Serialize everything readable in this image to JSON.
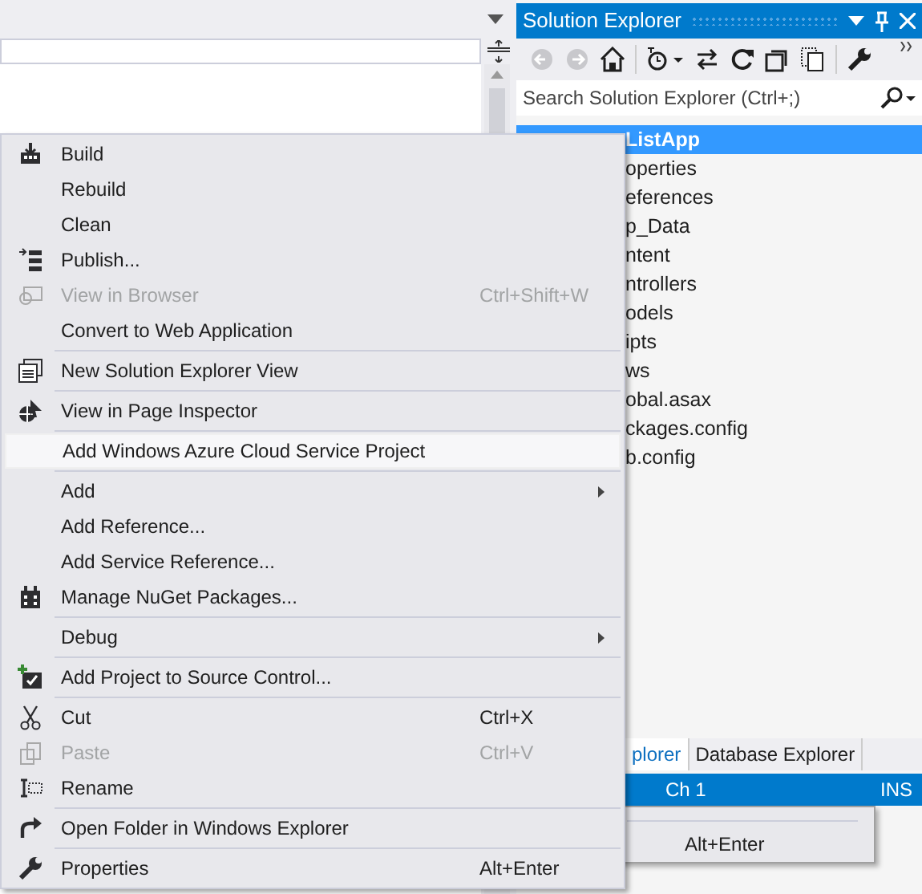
{
  "solution_explorer": {
    "title": "Solution Explorer",
    "search": {
      "placeholder": "Search Solution Explorer (Ctrl+;)"
    },
    "tree": [
      {
        "label": "ListApp",
        "selected": true
      },
      {
        "label": "operties",
        "selected": false
      },
      {
        "label": "eferences",
        "selected": false
      },
      {
        "label": "p_Data",
        "selected": false
      },
      {
        "label": "ntent",
        "selected": false
      },
      {
        "label": "ntrollers",
        "selected": false
      },
      {
        "label": "odels",
        "selected": false
      },
      {
        "label": "ipts",
        "selected": false
      },
      {
        "label": "ws",
        "selected": false
      },
      {
        "label": "obal.asax",
        "selected": false
      },
      {
        "label": "ckages.config",
        "selected": false
      },
      {
        "label": "b.config",
        "selected": false
      }
    ],
    "tabs": [
      {
        "label": "plorer",
        "selected": true
      },
      {
        "label": "Database Explorer",
        "selected": false
      }
    ]
  },
  "status_bar": {
    "column": "Ch 1",
    "mode": "INS"
  },
  "background_menu": {
    "shortcut": "Alt+Enter"
  },
  "context_menu": [
    {
      "kind": "item",
      "label": "Build",
      "disabled": false,
      "highlighted": false
    },
    {
      "kind": "item",
      "label": "Rebuild",
      "disabled": false,
      "highlighted": false
    },
    {
      "kind": "item",
      "label": "Clean",
      "disabled": false,
      "highlighted": false
    },
    {
      "kind": "item",
      "label": "Publish...",
      "disabled": false,
      "highlighted": false
    },
    {
      "kind": "item",
      "label": "View in Browser",
      "shortcut": "Ctrl+Shift+W",
      "disabled": true,
      "highlighted": false
    },
    {
      "kind": "item",
      "label": "Convert to Web Application",
      "disabled": false,
      "highlighted": false
    },
    {
      "kind": "separator"
    },
    {
      "kind": "item",
      "label": "New Solution Explorer View",
      "disabled": false,
      "highlighted": false
    },
    {
      "kind": "separator"
    },
    {
      "kind": "item",
      "label": "View in Page Inspector",
      "disabled": false,
      "highlighted": false
    },
    {
      "kind": "separator"
    },
    {
      "kind": "item",
      "label": "Add Windows Azure Cloud Service Project",
      "disabled": false,
      "highlighted": true
    },
    {
      "kind": "separator"
    },
    {
      "kind": "item",
      "label": "Add",
      "submenu": true,
      "disabled": false,
      "highlighted": false
    },
    {
      "kind": "item",
      "label": "Add Reference...",
      "disabled": false,
      "highlighted": false
    },
    {
      "kind": "item",
      "label": "Add Service Reference...",
      "disabled": false,
      "highlighted": false
    },
    {
      "kind": "item",
      "label": "Manage NuGet Packages...",
      "disabled": false,
      "highlighted": false
    },
    {
      "kind": "separator"
    },
    {
      "kind": "item",
      "label": "Debug",
      "submenu": true,
      "disabled": false,
      "highlighted": false
    },
    {
      "kind": "separator"
    },
    {
      "kind": "item",
      "label": "Add Project to Source Control...",
      "disabled": false,
      "highlighted": false
    },
    {
      "kind": "separator"
    },
    {
      "kind": "item",
      "label": "Cut",
      "shortcut": "Ctrl+X",
      "disabled": false,
      "highlighted": false
    },
    {
      "kind": "item",
      "label": "Paste",
      "shortcut": "Ctrl+V",
      "disabled": true,
      "highlighted": false
    },
    {
      "kind": "item",
      "label": "Rename",
      "disabled": false,
      "highlighted": false
    },
    {
      "kind": "separator"
    },
    {
      "kind": "item",
      "label": "Open Folder in Windows Explorer",
      "disabled": false,
      "highlighted": false
    },
    {
      "kind": "separator"
    },
    {
      "kind": "item",
      "label": "Properties",
      "shortcut": "Alt+Enter",
      "disabled": false,
      "highlighted": false
    }
  ]
}
